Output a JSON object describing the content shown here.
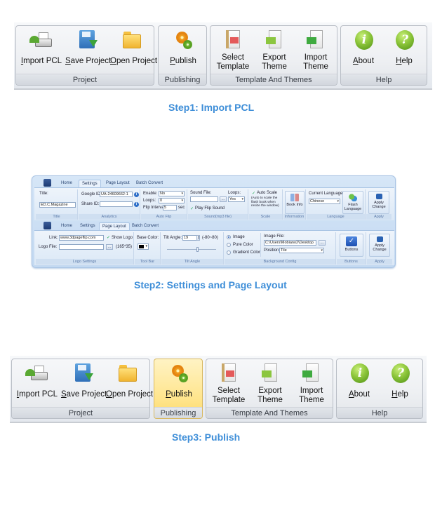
{
  "step1": {
    "title": "Step1: Import PCL",
    "ribbon": {
      "groups": [
        {
          "label": "Project",
          "buttons": [
            {
              "label": "Import PCL",
              "accel": "I",
              "rest": "mport PCL",
              "icon": "import-pcl-icon"
            },
            {
              "label": "Save Project",
              "accel": "S",
              "rest": "ave Project",
              "icon": "save-project-icon"
            },
            {
              "label": "Open Project",
              "accel": "O",
              "rest": "pen Project",
              "icon": "open-project-icon"
            }
          ]
        },
        {
          "label": "Publishing",
          "buttons": [
            {
              "label": "Publish",
              "accel": "P",
              "rest": "ublish",
              "icon": "publish-icon"
            }
          ]
        },
        {
          "label": "Template  And Themes",
          "buttons": [
            {
              "line1": "Select",
              "line2": "Template",
              "icon": "select-template-icon"
            },
            {
              "line1": "Export",
              "line2": "Theme",
              "icon": "export-theme-icon"
            },
            {
              "line1": "Import",
              "line2": "Theme",
              "icon": "import-theme-icon"
            }
          ]
        },
        {
          "label": "Help",
          "buttons": [
            {
              "label": "About",
              "accel": "A",
              "rest": "bout",
              "icon": "about-icon",
              "glyph": "i"
            },
            {
              "label": "Help",
              "accel": "H",
              "rest": "elp",
              "icon": "help-icon",
              "glyph": "?"
            }
          ]
        }
      ]
    }
  },
  "step2": {
    "title": "Step2: Settings and Page Layout",
    "settings_ribbon": {
      "tabs": [
        "Home",
        "Settings",
        "Page Layout",
        "Batch Convert"
      ],
      "active_tab": "Settings",
      "title_group": {
        "label": "Title",
        "field_label": "Title:",
        "field_value": "ED.C.Magazine"
      },
      "analytics_group": {
        "label": "Analytics",
        "google_id_label": "Google ID:",
        "google_id_value": "UA-24609662-1",
        "share_id_label": "Share ID:",
        "share_id_value": ""
      },
      "auto_flip_group": {
        "label": "Auto Flip",
        "enable_label": "Enable:",
        "enable_value": "No",
        "loops_label": "Loops:",
        "loops_value": "0",
        "interval_label": "Flip Interval:",
        "interval_value": "5",
        "interval_unit": "sec"
      },
      "sound_group": {
        "label": "Sound(mp3 file)",
        "sound_file_label": "Sound File:",
        "sound_file_value": "",
        "browse": "...",
        "loops_label": "Loops:",
        "loops_value": "Yes",
        "play_flip_sound": "Play Flip Sound",
        "play_flip_checked": true
      },
      "scale_group": {
        "label": "Scale",
        "auto_scale": "Auto Scale",
        "auto_scale_checked": true,
        "note": "(Auto to scale the flash book when resize the window)"
      },
      "information_group": {
        "label": "Information",
        "button": "Book Info"
      },
      "language_group": {
        "label": "Language",
        "current_label": "Current Language:",
        "current_value": "Chinese",
        "button_line1": "Flash",
        "button_line2": "Language"
      },
      "apply_group": {
        "label": "Apply",
        "button_line1": "Apply",
        "button_line2": "Change"
      }
    },
    "page_layout_ribbon": {
      "tabs": [
        "Home",
        "Settings",
        "Page Layout",
        "Batch Convert"
      ],
      "active_tab": "Page Layout",
      "logo_group": {
        "label": "Logo Settings",
        "link_label": "Link:",
        "link_value": "www.3dpageflip.com",
        "show_logo": "Show Logo",
        "show_logo_checked": true,
        "logo_file_label": "Logo File:",
        "logo_file_value": "",
        "browse": "...",
        "size_hint": "(165*35)"
      },
      "toolbar_group": {
        "label": "Tool Bar",
        "base_color_label": "Base Color:",
        "base_color": "#000000"
      },
      "tilt_group": {
        "label": "Tilt Angle",
        "tilt_label": "Tilt Angle:",
        "tilt_value": "19",
        "range": "(-80~80)",
        "slider_fraction": 0.6
      },
      "background_group": {
        "label": "Background Config",
        "options": [
          "Image",
          "Pure Color",
          "Gradient Color"
        ],
        "selected": "Image",
        "image_file_label": "Image File:",
        "image_file_value": "C:\\Users\\Mobiano2\\Desktop",
        "browse": "...",
        "position_label": "Position:",
        "position_value": "Tile"
      },
      "buttons_group": {
        "label": "Buttons",
        "button": "Buttons"
      },
      "apply_group": {
        "label": "Apply",
        "button_line1": "Apply",
        "button_line2": "Change"
      }
    }
  },
  "step3": {
    "title": "Step3: Publish",
    "active_group": "Publishing"
  },
  "colors": {
    "step_title": "#3e8ed8",
    "publish_highlight": "#ffe48a"
  }
}
